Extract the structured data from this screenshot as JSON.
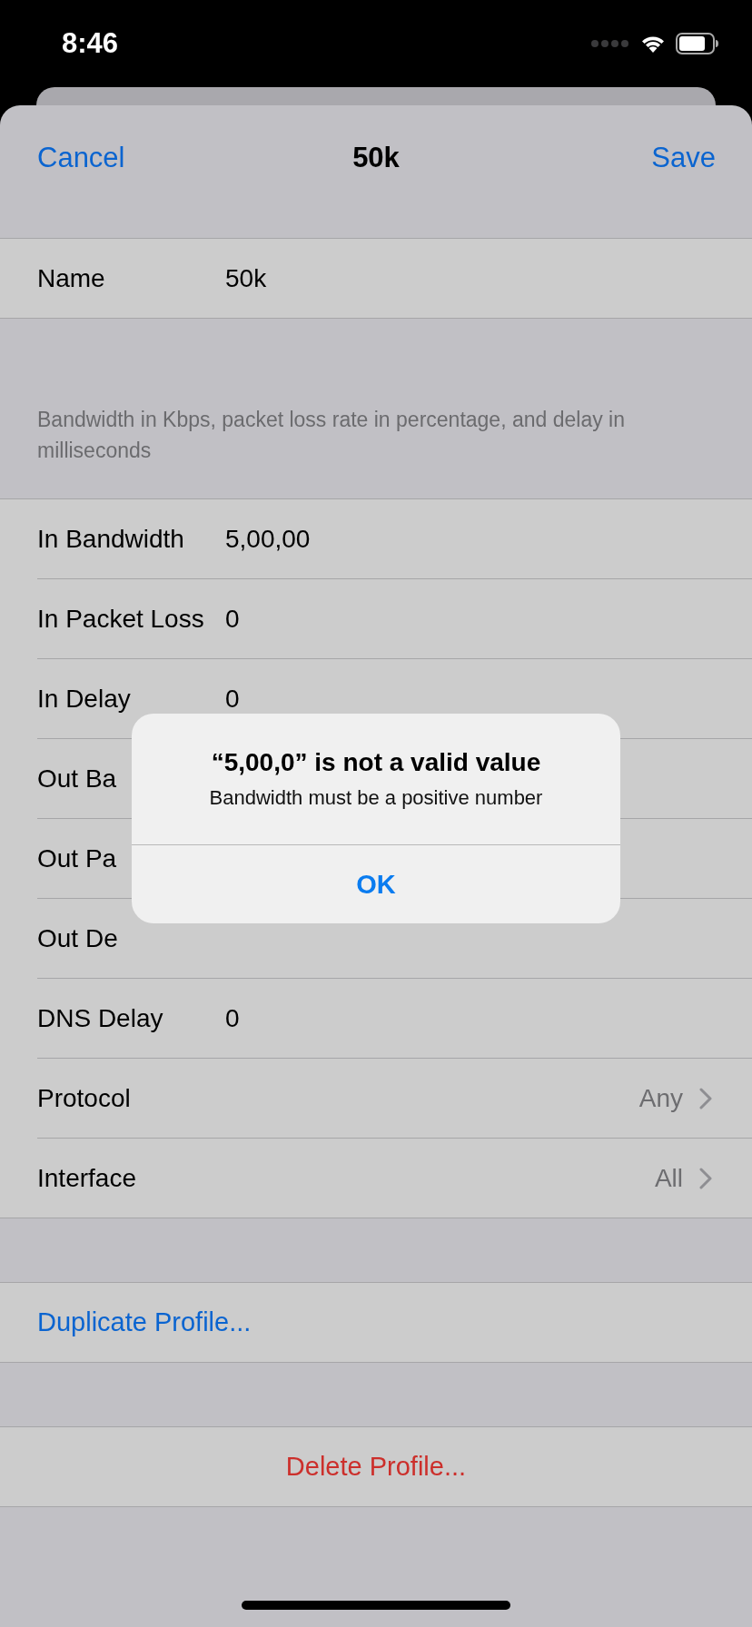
{
  "status_bar": {
    "time": "8:46"
  },
  "nav": {
    "cancel": "Cancel",
    "title": "50k",
    "save": "Save"
  },
  "name_row": {
    "label": "Name",
    "value": "50k"
  },
  "section_footer": "Bandwidth in Kbps, packet loss rate in percentage, and delay in milliseconds",
  "fields": [
    {
      "kind": "field",
      "label": "In Bandwidth",
      "value": "5,00,00"
    },
    {
      "kind": "field",
      "label": "In Packet Loss",
      "value": "0"
    },
    {
      "kind": "field",
      "label": "In Delay",
      "value": "0"
    },
    {
      "kind": "field",
      "label": "Out Ba"
    },
    {
      "kind": "field",
      "label": "Out Pa"
    },
    {
      "kind": "field",
      "label": "Out De"
    },
    {
      "kind": "field",
      "label": "DNS Delay",
      "value": "0"
    },
    {
      "kind": "picker",
      "label": "Protocol",
      "value": "Any"
    },
    {
      "kind": "picker",
      "label": "Interface",
      "value": "All"
    }
  ],
  "duplicate_action": "Duplicate Profile...",
  "delete_action": "Delete Profile...",
  "alert": {
    "title": "“5,00,0” is not a valid value",
    "message": "Bandwidth must be a positive number",
    "button": "OK"
  }
}
